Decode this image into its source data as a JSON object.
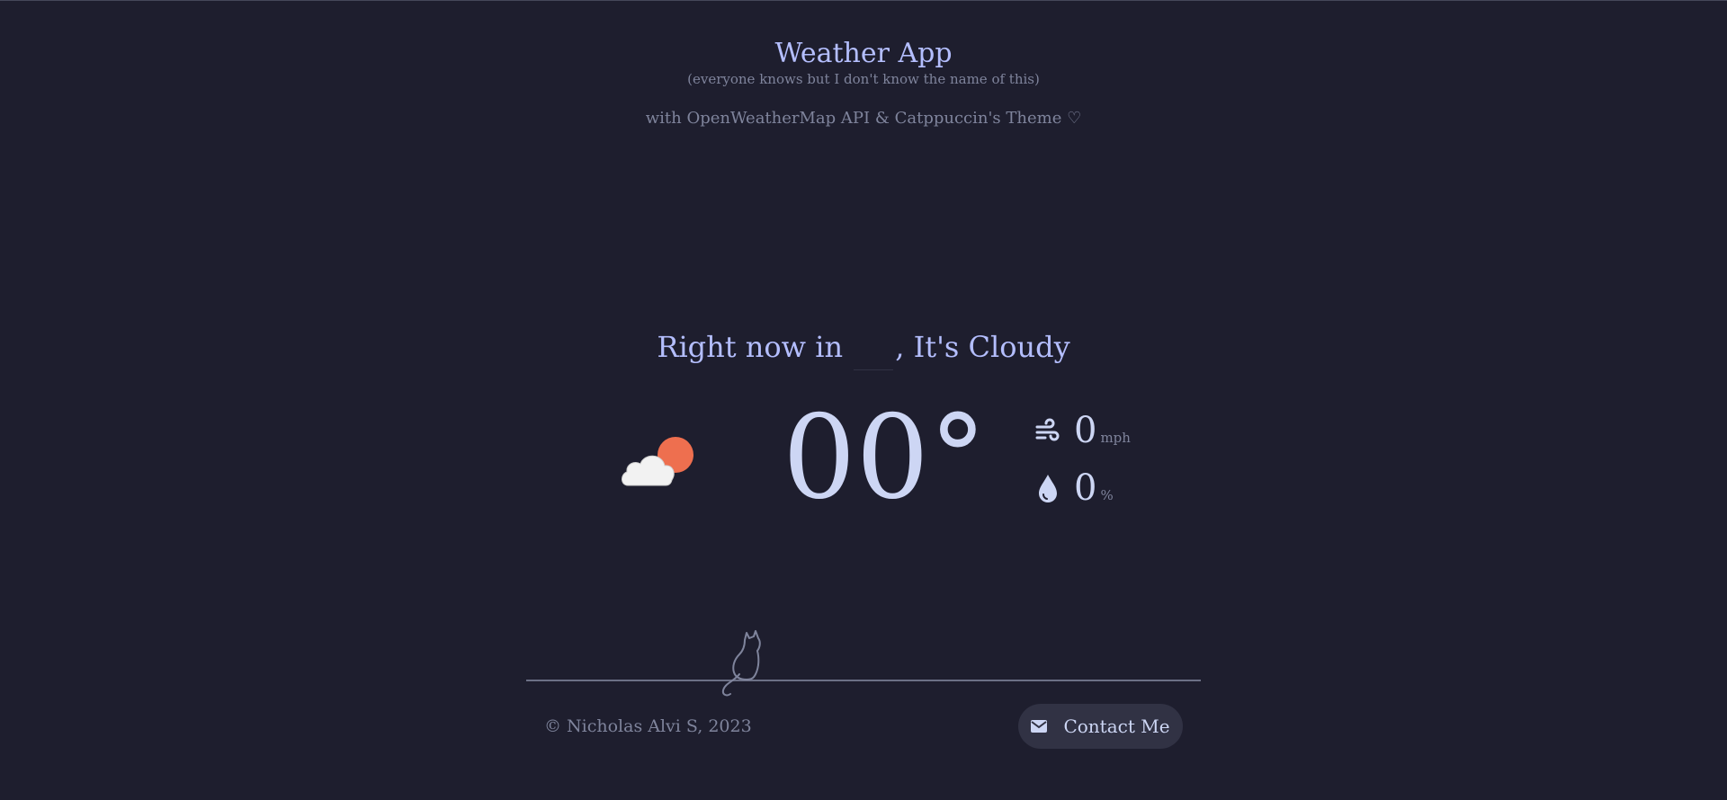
{
  "header": {
    "title": "Weather App",
    "subtitle": "(everyone knows but I don't know the name of this)",
    "credit": "with OpenWeatherMap API & Catppuccin's Theme ♡"
  },
  "current": {
    "prefix": "Right now in",
    "city_value": "",
    "suffix": ", It's Cloudy",
    "icon": "cloud-sun-icon",
    "temperature": "00°",
    "wind_value": "0",
    "wind_unit": "mph",
    "humidity_value": "0",
    "humidity_unit": "%"
  },
  "footer": {
    "copyright": "© Nicholas Alvi S, 2023",
    "contact_label": "Contact Me"
  },
  "colors": {
    "background": "#1e1e2e",
    "text": "#cdd6f4",
    "accent": "#b4befe",
    "muted": "#7f849c",
    "sun": "#ee6f4f",
    "button": "#313244"
  }
}
